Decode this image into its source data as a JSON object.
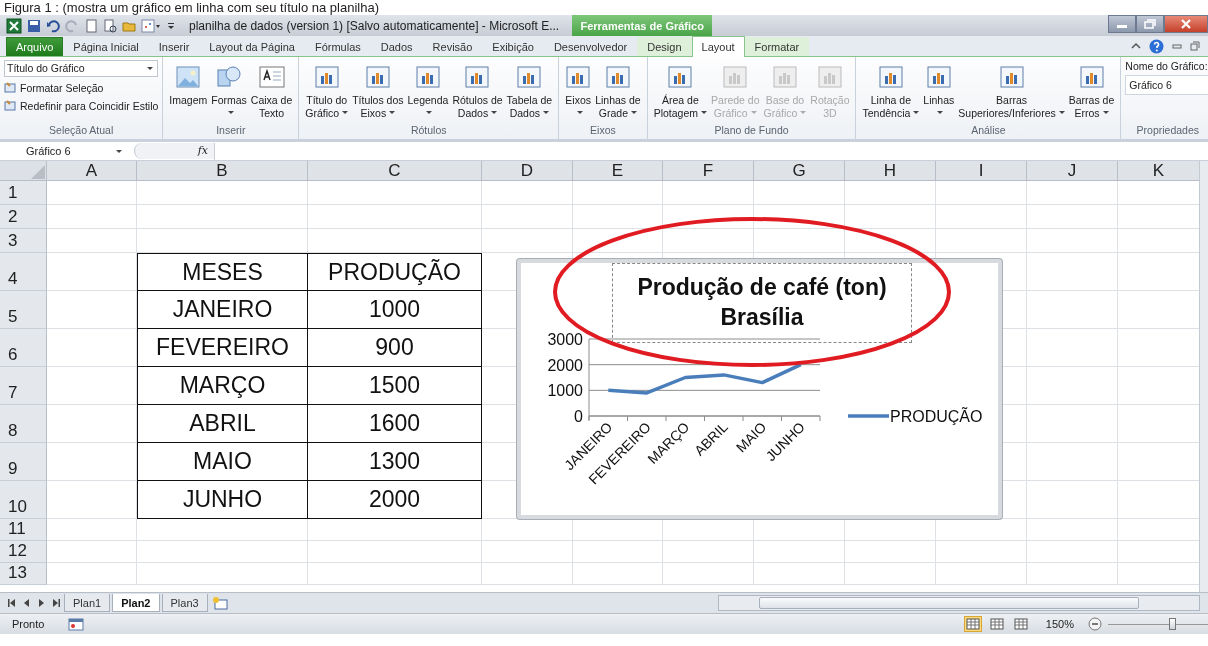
{
  "caption": "Figura 1 : (mostra um gráfico em linha com seu título na planilha)",
  "window": {
    "title": "planilha de dados (version 1) [Salvo automaticamente] - Microsoft E...",
    "context_header": "Ferramentas de Gráfico"
  },
  "ribbon_tabs": [
    {
      "label": "Arquivo",
      "kind": "file",
      "selected": false
    },
    {
      "label": "Página Inicial",
      "kind": "normal",
      "selected": false
    },
    {
      "label": "Inserir",
      "kind": "normal",
      "selected": false
    },
    {
      "label": "Layout da Página",
      "kind": "normal",
      "selected": false
    },
    {
      "label": "Fórmulas",
      "kind": "normal",
      "selected": false
    },
    {
      "label": "Dados",
      "kind": "normal",
      "selected": false
    },
    {
      "label": "Revisão",
      "kind": "normal",
      "selected": false
    },
    {
      "label": "Exibição",
      "kind": "normal",
      "selected": false
    },
    {
      "label": "Desenvolvedor",
      "kind": "normal",
      "selected": false
    },
    {
      "label": "Design",
      "kind": "context",
      "selected": false
    },
    {
      "label": "Layout",
      "kind": "context",
      "selected": true
    },
    {
      "label": "Formatar",
      "kind": "context",
      "selected": false
    }
  ],
  "ribbon_groups": [
    {
      "label": "Seleção Atual",
      "kind": "selection",
      "dropdown_value": "Título do Gráfico",
      "commands": [
        "Formatar Seleção",
        "Redefinir para Coincidir Estilo"
      ]
    },
    {
      "label": "Inserir",
      "kind": "insert",
      "items": [
        {
          "lines": [
            "Imagem"
          ],
          "dropdown": false,
          "disabled": false
        },
        {
          "lines": [
            "Formas"
          ],
          "dropdown": true,
          "disabled": false
        },
        {
          "lines": [
            "Caixa de",
            "Texto"
          ],
          "dropdown": false,
          "disabled": false
        }
      ]
    },
    {
      "label": "Rótulos",
      "kind": "buttons",
      "items": [
        {
          "lines": [
            "Título do",
            "Gráfico"
          ],
          "dropdown": true,
          "disabled": false
        },
        {
          "lines": [
            "Títulos dos",
            "Eixos"
          ],
          "dropdown": true,
          "disabled": false
        },
        {
          "lines": [
            "Legenda"
          ],
          "dropdown": true,
          "disabled": false
        },
        {
          "lines": [
            "Rótulos de",
            "Dados"
          ],
          "dropdown": true,
          "disabled": false
        },
        {
          "lines": [
            "Tabela de",
            "Dados"
          ],
          "dropdown": true,
          "disabled": false
        }
      ]
    },
    {
      "label": "Eixos",
      "kind": "buttons",
      "items": [
        {
          "lines": [
            "Eixos"
          ],
          "dropdown": true,
          "disabled": false
        },
        {
          "lines": [
            "Linhas de",
            "Grade"
          ],
          "dropdown": true,
          "disabled": false
        }
      ]
    },
    {
      "label": "Plano de Fundo",
      "kind": "buttons",
      "items": [
        {
          "lines": [
            "Área de",
            "Plotagem"
          ],
          "dropdown": true,
          "disabled": false
        },
        {
          "lines": [
            "Parede do",
            "Gráfico"
          ],
          "dropdown": true,
          "disabled": true
        },
        {
          "lines": [
            "Base do",
            "Gráfico"
          ],
          "dropdown": true,
          "disabled": true
        },
        {
          "lines": [
            "Rotação",
            "3D"
          ],
          "dropdown": false,
          "disabled": true
        }
      ]
    },
    {
      "label": "Análise",
      "kind": "buttons",
      "items": [
        {
          "lines": [
            "Linha de",
            "Tendência"
          ],
          "dropdown": true,
          "disabled": false
        },
        {
          "lines": [
            "Linhas"
          ],
          "dropdown": true,
          "disabled": false
        },
        {
          "lines": [
            "Barras",
            "Superiores/Inferiores"
          ],
          "dropdown": true,
          "disabled": false
        },
        {
          "lines": [
            "Barras de",
            "Erros"
          ],
          "dropdown": true,
          "disabled": false
        }
      ]
    },
    {
      "label": "Propriedades",
      "kind": "properties",
      "field_label": "Nome do Gráfico:",
      "field_value": "Gráfico 6"
    }
  ],
  "formula_bar": {
    "name_box": "Gráfico 6",
    "fx": "fx"
  },
  "sheet": {
    "columns": [
      "A",
      "B",
      "C",
      "D",
      "E",
      "F",
      "G",
      "H",
      "I",
      "J",
      "K"
    ],
    "rows": [
      "1",
      "2",
      "3",
      "4",
      "5",
      "6",
      "7",
      "8",
      "9",
      "10",
      "11",
      "12",
      "13"
    ],
    "table": {
      "header": [
        "MESES",
        "PRODUÇÃO"
      ],
      "rows": [
        [
          "JANEIRO",
          "1000"
        ],
        [
          "FEVEREIRO",
          "900"
        ],
        [
          "MARÇO",
          "1500"
        ],
        [
          "ABRIL",
          "1600"
        ],
        [
          "MAIO",
          "1300"
        ],
        [
          "JUNHO",
          "2000"
        ]
      ]
    }
  },
  "chart": {
    "chart_data": {
      "type": "line",
      "title": "Produção de café (ton) Brasília",
      "categories": [
        "JANEIRO",
        "FEVEREIRO",
        "MARÇO",
        "ABRIL",
        "MAIO",
        "JUNHO"
      ],
      "series": [
        {
          "name": "PRODUÇÃO",
          "color": "#4a7ebb",
          "values": [
            1000,
            900,
            1500,
            1600,
            1300,
            2000
          ]
        }
      ],
      "ylim": [
        0,
        3000
      ],
      "yticks": [
        0,
        1000,
        2000,
        3000
      ]
    }
  },
  "sheet_tabs": [
    {
      "label": "Plan1",
      "selected": false
    },
    {
      "label": "Plan2",
      "selected": true
    },
    {
      "label": "Plan3",
      "selected": false
    }
  ],
  "status_bar": {
    "text": "Pronto",
    "views": [
      {
        "selected": true
      },
      {
        "selected": false
      },
      {
        "selected": false
      }
    ],
    "zoom": "150%",
    "zoom_slider": {
      "level": 0.58
    }
  }
}
